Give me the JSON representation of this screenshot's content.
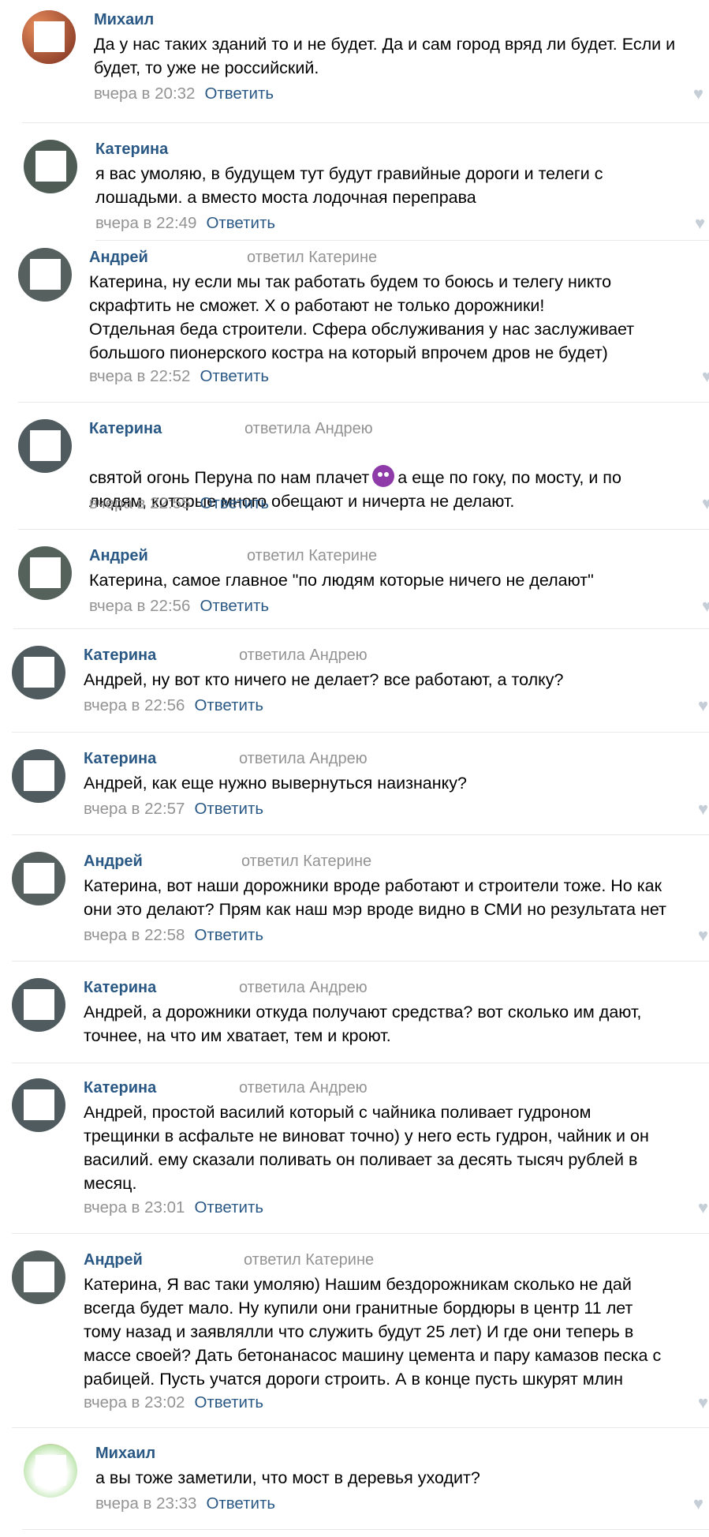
{
  "comments": [
    {
      "name": "Михаил",
      "reply_to": "",
      "text": "Да у нас таких зданий то и не будет. Да и сам город вряд ли будет. Если и\nбудет, то уже не российский.",
      "time": "вчера в 20:32",
      "reply_label": "Ответить"
    },
    {
      "name": "Катерина",
      "reply_to": "",
      "text": "я вас умоляю, в будущем тут будут гравийные дороги и телеги с\nлошадьми. а вместо моста лодочная переправа",
      "time": "вчера в 22:49",
      "reply_label": "Ответить"
    },
    {
      "name": "Андрей",
      "reply_to": "ответил Катерине",
      "text": "Катерина, ну если мы так работать будем то боюсь и телегу никто\nскрафтить не сможет. Х        о работают не только дорожники!\nОтдельная беда строители. Сфера обслуживания у нас заслуживает\nбольшого пионерского костра на который впрочем дров не будет)",
      "time": "вчера в 22:52",
      "reply_label": "Ответить"
    },
    {
      "name": "Катерина",
      "reply_to": "ответила Андрею",
      "text_before": "святой огонь Перуна по нам плачет",
      "emoji": "devil-emoji",
      "text_after": "а еще по гоку, по мосту, и по\nлюдям, которые много обещают и ничерта не делают.",
      "time": "вчера в 22:55",
      "reply_label": "Ответить"
    },
    {
      "name": "Андрей",
      "reply_to": "ответил Катерине",
      "text": "Катерина, самое главное \"по людям которые ничего не делают\"",
      "time": "вчера в 22:56",
      "reply_label": "Ответить"
    },
    {
      "name": "Катерина",
      "reply_to": "ответила Андрею",
      "text": "Андрей, ну вот кто ничего не делает? все работают, а толку?",
      "time": "вчера в 22:56",
      "reply_label": "Ответить"
    },
    {
      "name": "Катерина",
      "reply_to": "ответила Андрею",
      "text": "Андрей, как еще нужно вывернуться наизнанку?",
      "time": "вчера в 22:57",
      "reply_label": "Ответить"
    },
    {
      "name": "Андрей",
      "reply_to": "ответил Катерине",
      "text": "Катерина, вот наши дорожники вроде работают и строители тоже. Но как\nони это делают? Прям как наш мэр вроде видно в СМИ но результата нет",
      "time": "вчера в 22:58",
      "reply_label": "Ответить"
    },
    {
      "name": "Катерина",
      "reply_to": "ответила Андрею",
      "text": "Андрей, а дорожники откуда получают средства? вот сколько им дают,\nточнее, на что им хватает, тем и кроют.",
      "time": "",
      "reply_label": ""
    },
    {
      "name": "Катерина",
      "reply_to": "ответила Андрею",
      "text": "Андрей, простой василий который с чайника поливает гудроном\nтрещинки в асфальте не виноват точно) у него есть гудрон, чайник и он\nвасилий. ему сказали поливать он поливает за десять тысяч рублей в\nмесяц.",
      "time": "вчера в 23:01",
      "reply_label": "Ответить"
    },
    {
      "name": "Андрей",
      "reply_to": "ответил Катерине",
      "text": "Катерина, Я вас таки умоляю) Нашим бездорожникам сколько не дай\nвсегда будет мало. Ну купили они гранитные бордюры в центр 11 лет\nтому назад и заявлялли что служить будут 25 лет) И где они теперь в\nмассе своей? Дать бетонанасос машину цемента и пару камазов песка с\nрабицей. Пусть учатся дороги строить. А в конце пусть шкурят млин",
      "time": "вчера в 23:02",
      "reply_label": "Ответить"
    },
    {
      "name": "Михаил",
      "reply_to": "",
      "text": "а вы тоже заметили, что мост в деревья уходит?",
      "time": "вчера в 23:33",
      "reply_label": "Ответить"
    }
  ],
  "colors": {
    "name": "#2a5885",
    "muted": "#939393",
    "link": "#2a5885"
  },
  "icons": {
    "like": "heart-icon"
  }
}
